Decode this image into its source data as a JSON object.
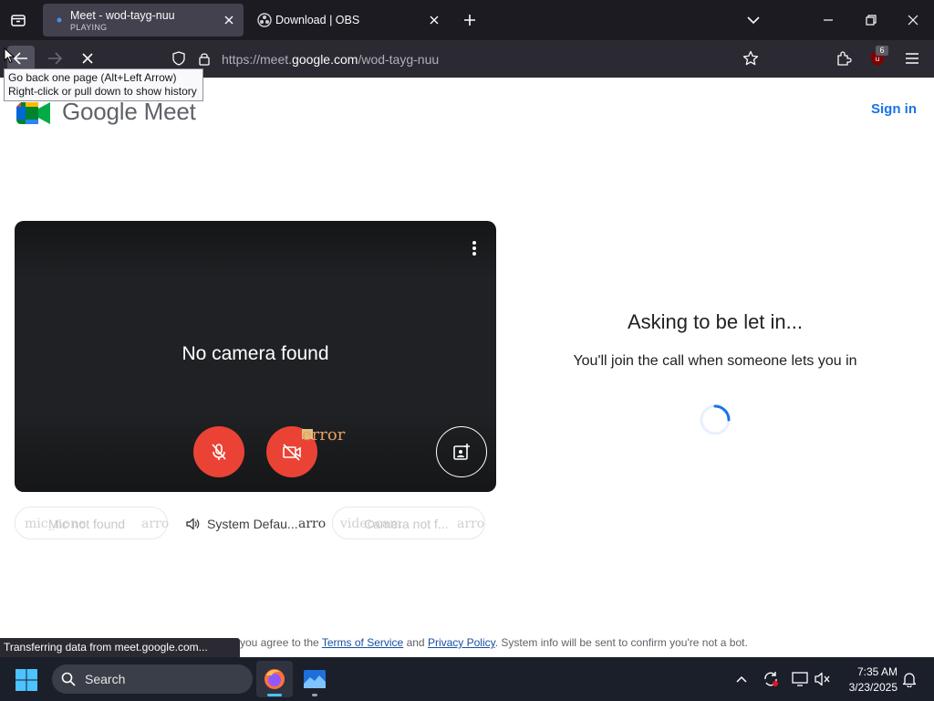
{
  "browser": {
    "tabs": [
      {
        "title": "Meet - wod-tayg-nuu",
        "subtitle": "PLAYING",
        "active": true
      },
      {
        "title": "Download | OBS",
        "active": false
      }
    ],
    "url_prefix": "https://meet.",
    "url_domain": "google.com",
    "url_path": "/wod-tayg-nuu",
    "extension_badge": "6",
    "tooltip_line1": "Go back one page (Alt+Left Arrow)",
    "tooltip_line2": "Right-click or pull down to show history",
    "status_text": "Transferring data from meet.google.com..."
  },
  "meet": {
    "wordmark": "Google Meet",
    "sign_in": "Sign in",
    "no_camera": "No camera found",
    "camera_error_text": "error",
    "mic_chip_ghost": "mic_none",
    "mic_chip_label": "Mic not found",
    "mic_chip_arrow": "arro",
    "speaker_chip_label": "System Defau...",
    "speaker_chip_arrow": "arro",
    "cam_chip_ghost": "videocam",
    "cam_chip_label": "Camera not f...",
    "cam_chip_arrow": "arro",
    "ask_title": "Asking to be let in...",
    "ask_subtitle": "You'll join the call when someone lets you in",
    "terms_prefix": "you agree to the",
    "terms_link": "Terms of Service",
    "terms_and": "and",
    "privacy_link": "Privacy Policy",
    "terms_suffix": ". System info will be sent to confirm you're not a bot."
  },
  "taskbar": {
    "search_label": "Search",
    "time": "7:35 AM",
    "date": "3/23/2025"
  },
  "colors": {
    "meet_red": "#ea4335",
    "link_blue": "#1a73e8",
    "tab_strip": "#1c1b22",
    "nav_bar": "#2b2a33",
    "taskbar": "#1b1f2a"
  }
}
